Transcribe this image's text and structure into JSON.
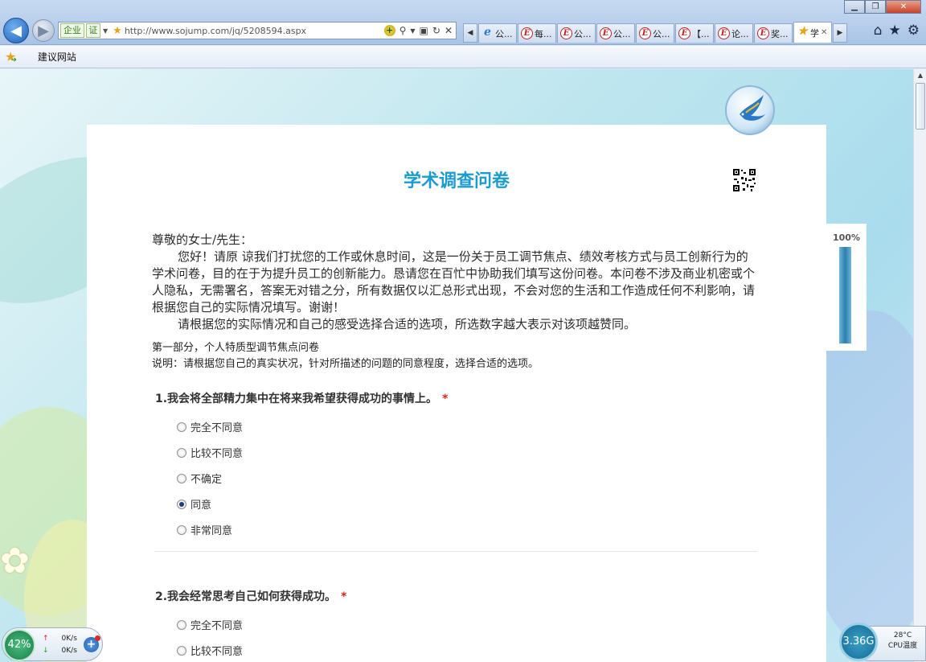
{
  "browser": {
    "address_badge_1": "企业",
    "address_badge_2": "证",
    "url": "http://www.sojump.com/jq/5208594.aspx",
    "tabs": [
      {
        "label": "公...",
        "icon": "ie-icon"
      },
      {
        "label": "每...",
        "icon": "e-icon"
      },
      {
        "label": "公...",
        "icon": "e-icon"
      },
      {
        "label": "公...",
        "icon": "e-icon"
      },
      {
        "label": "公...",
        "icon": "e-icon"
      },
      {
        "label": "【...",
        "icon": "e-icon"
      },
      {
        "label": "论...",
        "icon": "e-icon"
      },
      {
        "label": "奖...",
        "icon": "e-icon"
      },
      {
        "label": "学",
        "icon": "star-icon"
      }
    ],
    "favorites": {
      "link": "建议网站"
    }
  },
  "survey": {
    "title": "学术调查问卷",
    "greeting": "尊敬的女士/先生：",
    "intro_1": "您好！请原 谅我们打扰您的工作或休息时间，这是一份关于员工调节焦点、绩效考核方式与员工创新行为的学术问卷，目的在于为提升员工的创新能力。恳请您在百忙中协助我们填写这份问卷。本问卷不涉及商业机密或个人隐私，无需署名，答案无对错之分，所有数据仅以汇总形式出现，不会对您的生活和工作造成任何不利影响，请根据您自己的实际情况填写。谢谢！",
    "intro_2": "请根据您的实际情况和自己的感受选择合适的选项，所选数字越大表示对该项越赞同。",
    "section_title": "第一部分，个人特质型调节焦点问卷",
    "section_note": "说明：请根据您自己的真实状况，针对所描述的问题的同意程度，选择合适的选项。",
    "questions": [
      {
        "text": "1.我会将全部精力集中在将来我希望获得成功的事情上。",
        "required": "*",
        "options": [
          "完全不同意",
          "比较不同意",
          "不确定",
          "同意",
          "非常同意"
        ],
        "selected": "同意"
      },
      {
        "text": "2.我会经常思考自己如何获得成功。",
        "required": "*",
        "options": [
          "完全不同意",
          "比较不同意"
        ],
        "selected": ""
      }
    ],
    "progress": {
      "label": "100%",
      "fraction": 1.0
    }
  },
  "widgets": {
    "net": {
      "percent": "42%",
      "up": "0K/s",
      "down": "0K/s"
    },
    "cpu": {
      "value": "3.36G",
      "temp": "28°C",
      "label": "CPU温度"
    }
  },
  "colors": {
    "title": "#1b9bcf",
    "required": "#e02020",
    "accent_blue": "#1d3f7a"
  }
}
